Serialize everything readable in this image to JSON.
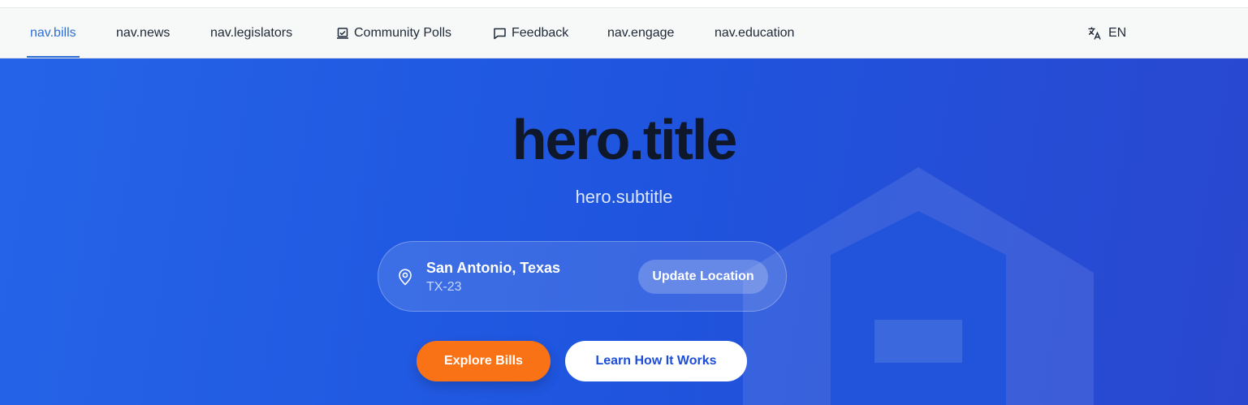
{
  "nav": {
    "items": [
      {
        "label": "nav.bills",
        "active": true
      },
      {
        "label": "nav.news"
      },
      {
        "label": "nav.legislators"
      },
      {
        "label": "Community Polls",
        "icon": "poll-icon"
      },
      {
        "label": "Feedback",
        "icon": "chat-bubble-icon"
      },
      {
        "label": "nav.engage"
      },
      {
        "label": "nav.education"
      }
    ],
    "language": {
      "label": "EN",
      "icon": "translate-icon"
    }
  },
  "hero": {
    "title": "hero.title",
    "subtitle": "hero.subtitle",
    "location": {
      "city": "San Antonio, Texas",
      "district": "TX-23",
      "update_label": "Update Location",
      "icon": "map-pin-icon"
    },
    "primary_cta": "Explore Bills",
    "secondary_cta": "Learn How It Works"
  },
  "colors": {
    "accent_blue": "#2f6fd6",
    "hero_blue": "#2160e6",
    "cta_orange": "#f97316"
  }
}
